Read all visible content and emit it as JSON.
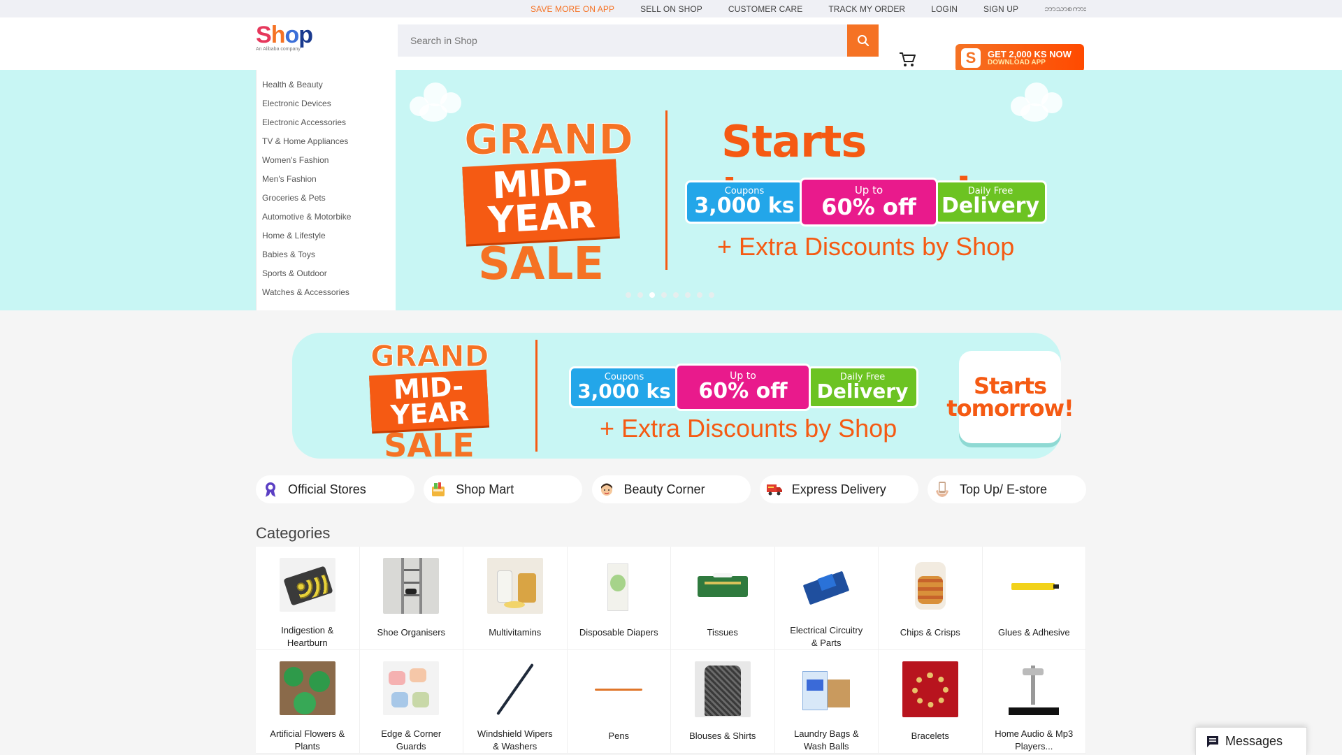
{
  "topbar": {
    "links": [
      "SAVE MORE ON APP",
      "SELL ON SHOP",
      "CUSTOMER CARE",
      "TRACK MY ORDER",
      "LOGIN",
      "SIGN UP",
      "ဘာသာစကား"
    ]
  },
  "header": {
    "logo_text": "Shop",
    "logo_tagline": "An Alibaba company",
    "search_placeholder": "Search in Shop",
    "promo_line1": "GET 2,000 KS NOW",
    "promo_line2": "DOWNLOAD APP",
    "promo_icon_letter": "S"
  },
  "sidebar_categories": [
    "Health & Beauty",
    "Electronic Devices",
    "Electronic Accessories",
    "TV & Home Appliances",
    "Women's Fashion",
    "Men's Fashion",
    "Groceries & Pets",
    "Automotive & Motorbike",
    "Home & Lifestyle",
    "Babies & Toys",
    "Sports & Outdoor",
    "Watches & Accessories"
  ],
  "hero": {
    "sale_grand": "GRAND",
    "sale_mid": "MID-YEAR",
    "sale_sale": "SALE",
    "headline": "Starts tomorrow!",
    "pill1_small": "Coupons",
    "pill1_big": "3,000 ks",
    "pill2_small": "Up to",
    "pill2_big": "60% off",
    "pill3_small": "Daily Free",
    "pill3_big": "Delivery",
    "extra": "+ Extra Discounts by Shop",
    "slide_count": 8,
    "active_slide": 3
  },
  "banner2": {
    "sale_grand": "GRAND",
    "sale_mid": "MID-YEAR",
    "sale_sale": "SALE",
    "pill1_small": "Coupons",
    "pill1_big": "3,000 ks",
    "pill2_small": "Up to",
    "pill2_big": "60% off",
    "pill3_small": "Daily Free",
    "pill3_big": "Delivery",
    "extra": "+ Extra Discounts by Shop",
    "tomorrow_line1": "Starts",
    "tomorrow_line2": "tomorrow!"
  },
  "quick_links": [
    {
      "label": "Official Stores",
      "icon": "ribbon-icon"
    },
    {
      "label": "Shop Mart",
      "icon": "grocery-bag-icon"
    },
    {
      "label": "Beauty Corner",
      "icon": "beauty-face-icon"
    },
    {
      "label": "Express Delivery",
      "icon": "delivery-truck-icon"
    },
    {
      "label": "Top Up/ E-store",
      "icon": "hand-phone-icon"
    }
  ],
  "categories_title": "Categories",
  "categories": [
    {
      "line1": "Indigestion &",
      "line2": "Heartburn"
    },
    {
      "line1": "Shoe Organisers",
      "line2": ""
    },
    {
      "line1": "Multivitamins",
      "line2": ""
    },
    {
      "line1": "Disposable Diapers",
      "line2": ""
    },
    {
      "line1": "Tissues",
      "line2": ""
    },
    {
      "line1": "Electrical Circuitry",
      "line2": "& Parts"
    },
    {
      "line1": "Chips & Crisps",
      "line2": ""
    },
    {
      "line1": "Glues & Adhesive",
      "line2": ""
    },
    {
      "line1": "Artificial Flowers &",
      "line2": "Plants"
    },
    {
      "line1": "Edge & Corner",
      "line2": "Guards"
    },
    {
      "line1": "Windshield Wipers",
      "line2": "& Washers"
    },
    {
      "line1": "Pens",
      "line2": ""
    },
    {
      "line1": "Blouses & Shirts",
      "line2": ""
    },
    {
      "line1": "Laundry Bags &",
      "line2": "Wash Balls"
    },
    {
      "line1": "Bracelets",
      "line2": ""
    },
    {
      "line1": "Home Audio & Mp3",
      "line2": "Players..."
    }
  ],
  "messages_label": "Messages",
  "colors": {
    "accent": "#f57224",
    "hero_bg": "#c8f6f4",
    "sale_orange": "#f55a13",
    "pill_blue": "#23a6e9",
    "pill_pink": "#e91a8c",
    "pill_green": "#6cc322"
  }
}
